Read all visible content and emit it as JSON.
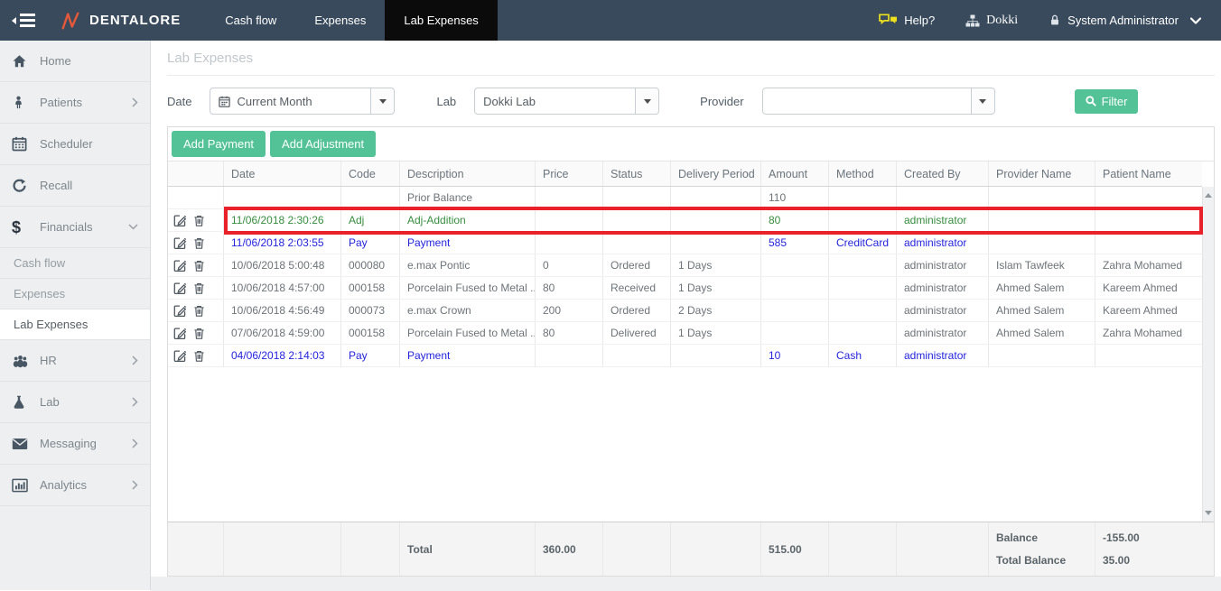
{
  "colors": {
    "navbar_bg": "#394a5c",
    "active_tab_bg": "#0b0b0b",
    "brand_orange": "#e5593a",
    "accent_green": "#53c296",
    "highlight_red": "#e8212b",
    "payment_blue": "#2424dd",
    "adjustment_green": "#378d3f",
    "help_yellow": "#f0e11d",
    "sidebar_bg": "#edeff0"
  },
  "topbar": {
    "brand": "DENTALORE",
    "tabs": [
      {
        "label": "Cash flow",
        "active": false
      },
      {
        "label": "Expenses",
        "active": false
      },
      {
        "label": "Lab Expenses",
        "active": true
      }
    ],
    "help_label": "Help?",
    "clinic_label": "Dokki",
    "user_label": "System Administrator"
  },
  "sidebar": {
    "items": [
      {
        "label": "Home",
        "icon": "home-icon",
        "chevron": "none"
      },
      {
        "label": "Patients",
        "icon": "patient-icon",
        "chevron": "right"
      },
      {
        "label": "Scheduler",
        "icon": "calendar-icon",
        "chevron": "none"
      },
      {
        "label": "Recall",
        "icon": "recall-icon",
        "chevron": "none"
      },
      {
        "label": "Financials",
        "icon": "dollar-icon",
        "chevron": "down",
        "children": [
          {
            "label": "Cash flow",
            "active": false
          },
          {
            "label": "Expenses",
            "active": false
          },
          {
            "label": "Lab Expenses",
            "active": true
          }
        ]
      },
      {
        "label": "HR",
        "icon": "group-icon",
        "chevron": "right"
      },
      {
        "label": "Lab",
        "icon": "flask-icon",
        "chevron": "right"
      },
      {
        "label": "Messaging",
        "icon": "envelope-icon",
        "chevron": "right"
      },
      {
        "label": "Analytics",
        "icon": "bar-chart-icon",
        "chevron": "right"
      }
    ]
  },
  "page": {
    "title": "Lab Expenses"
  },
  "filters": {
    "date_label": "Date",
    "date_value": "Current Month",
    "lab_label": "Lab",
    "lab_value": "Dokki Lab",
    "provider_label": "Provider",
    "provider_value": "",
    "filter_button": "Filter"
  },
  "toolbar": {
    "add_payment": "Add Payment",
    "add_adjustment": "Add Adjustment"
  },
  "grid": {
    "columns": [
      "Date",
      "Code",
      "Description",
      "Price",
      "Status",
      "Delivery Period",
      "Amount",
      "Method",
      "Created By",
      "Provider Name",
      "Patient Name"
    ],
    "rows": [
      {
        "date": "",
        "code": "",
        "description": "Prior Balance",
        "price": "",
        "status": "",
        "delivery": "",
        "amount": "110",
        "method": "",
        "created_by": "",
        "provider": "",
        "patient": "",
        "style": "normal",
        "has_actions": false,
        "highlighted": false
      },
      {
        "date": "11/06/2018 2:30:26",
        "code": "Adj",
        "description": "Adj-Addition",
        "price": "",
        "status": "",
        "delivery": "",
        "amount": "80",
        "method": "",
        "created_by": "administrator",
        "provider": "",
        "patient": "",
        "style": "adjustment",
        "has_actions": true,
        "highlighted": true
      },
      {
        "date": "11/06/2018 2:03:55",
        "code": "Pay",
        "description": "Payment",
        "price": "",
        "status": "",
        "delivery": "",
        "amount": "585",
        "method": "CreditCard",
        "created_by": "administrator",
        "provider": "",
        "patient": "",
        "style": "payment",
        "has_actions": true,
        "highlighted": false
      },
      {
        "date": "10/06/2018 5:00:48",
        "code": "000080",
        "description": "e.max Pontic",
        "price": "0",
        "status": "Ordered",
        "delivery": "1 Days",
        "amount": "",
        "method": "",
        "created_by": "administrator",
        "provider": "Islam Tawfeek",
        "patient": "Zahra Mohamed",
        "style": "normal",
        "has_actions": true,
        "highlighted": false
      },
      {
        "date": "10/06/2018 4:57:00",
        "code": "000158",
        "description": "Porcelain Fused to Metal ...",
        "price": "80",
        "status": "Received",
        "delivery": "1 Days",
        "amount": "",
        "method": "",
        "created_by": "administrator",
        "provider": "Ahmed Salem",
        "patient": "Kareem Ahmed",
        "style": "normal",
        "has_actions": true,
        "highlighted": false
      },
      {
        "date": "10/06/2018 4:56:49",
        "code": "000073",
        "description": "e.max Crown",
        "price": "200",
        "status": "Ordered",
        "delivery": "2 Days",
        "amount": "",
        "method": "",
        "created_by": "administrator",
        "provider": "Ahmed Salem",
        "patient": "Kareem Ahmed",
        "style": "normal",
        "has_actions": true,
        "highlighted": false
      },
      {
        "date": "07/06/2018 4:59:00",
        "code": "000158",
        "description": "Porcelain Fused to Metal ...",
        "price": "80",
        "status": "Delivered",
        "delivery": "1 Days",
        "amount": "",
        "method": "",
        "created_by": "administrator",
        "provider": "Ahmed Salem",
        "patient": "Zahra Mohamed",
        "style": "normal",
        "has_actions": true,
        "highlighted": false
      },
      {
        "date": "04/06/2018 2:14:03",
        "code": "Pay",
        "description": "Payment",
        "price": "",
        "status": "",
        "delivery": "",
        "amount": "10",
        "method": "Cash",
        "created_by": "administrator",
        "provider": "",
        "patient": "",
        "style": "payment",
        "has_actions": true,
        "highlighted": false
      }
    ],
    "footer": {
      "total_label": "Total",
      "total_price": "360.00",
      "total_amount": "515.00",
      "balance_label": "Balance",
      "balance_value": "-155.00",
      "total_balance_label": "Total Balance",
      "total_balance_value": "35.00"
    }
  }
}
